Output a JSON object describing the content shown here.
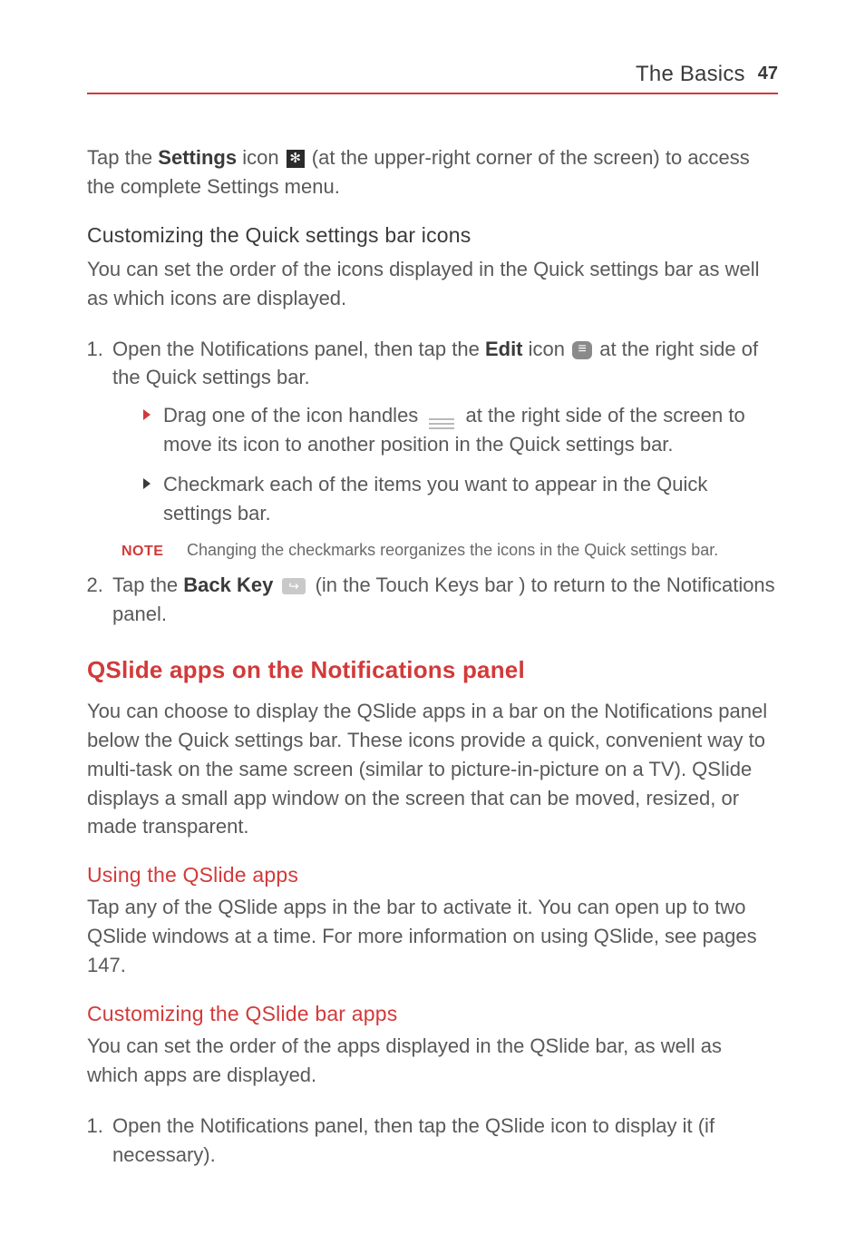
{
  "header": {
    "chapter": "The Basics",
    "page_number": "47"
  },
  "intro": {
    "pre": "Tap the ",
    "bold": "Settings",
    "post_icon_pre": " icon ",
    "post_icon": " (at the upper-right corner of the screen) to access the complete Settings menu."
  },
  "sec_customize_quick": {
    "heading": "Customizing the Quick settings bar icons",
    "para": "You can set the order of the icons displayed in the Quick settings bar as well as which icons are displayed.",
    "list1": {
      "item1_pre": "Open the Notifications panel, then tap the ",
      "item1_bold": "Edit",
      "item1_mid": " icon ",
      "item1_post": " at the right side of the Quick settings bar.",
      "sub1_pre": "Drag one of the icon handles ",
      "sub1_post": " at the right side of the screen to move its icon to another position in the Quick settings bar.",
      "sub2": "Checkmark each of the items you want to appear in the Quick settings bar."
    },
    "note_label": "NOTE",
    "note_text": "Changing the checkmarks reorganizes the icons in the Quick settings bar.",
    "item2_pre": "Tap the ",
    "item2_bold": "Back Key",
    "item2_post": " (in the Touch Keys bar ) to return to the Notifications panel."
  },
  "sec_qslide": {
    "heading": "QSlide apps on the Notifications panel",
    "para": "You can choose to display the QSlide apps in a bar on the Notifications panel below the Quick settings bar. These icons provide a quick, convenient way to multi-task on the same screen (similar to picture-in-picture on a TV). QSlide displays a small app window on the screen that can be moved, resized, or made transparent."
  },
  "sec_using_qslide": {
    "heading": "Using the QSlide apps",
    "para": "Tap any of the QSlide apps in the bar to activate it. You can open up to two QSlide windows at a time. For more information on using QSlide, see pages 147."
  },
  "sec_custom_qslide": {
    "heading": "Customizing the QSlide bar apps",
    "para": "You can set the order of the apps displayed in the QSlide bar, as well as which apps are displayed.",
    "item1": "Open the Notifications panel, then tap the QSlide icon to display it (if necessary)."
  }
}
